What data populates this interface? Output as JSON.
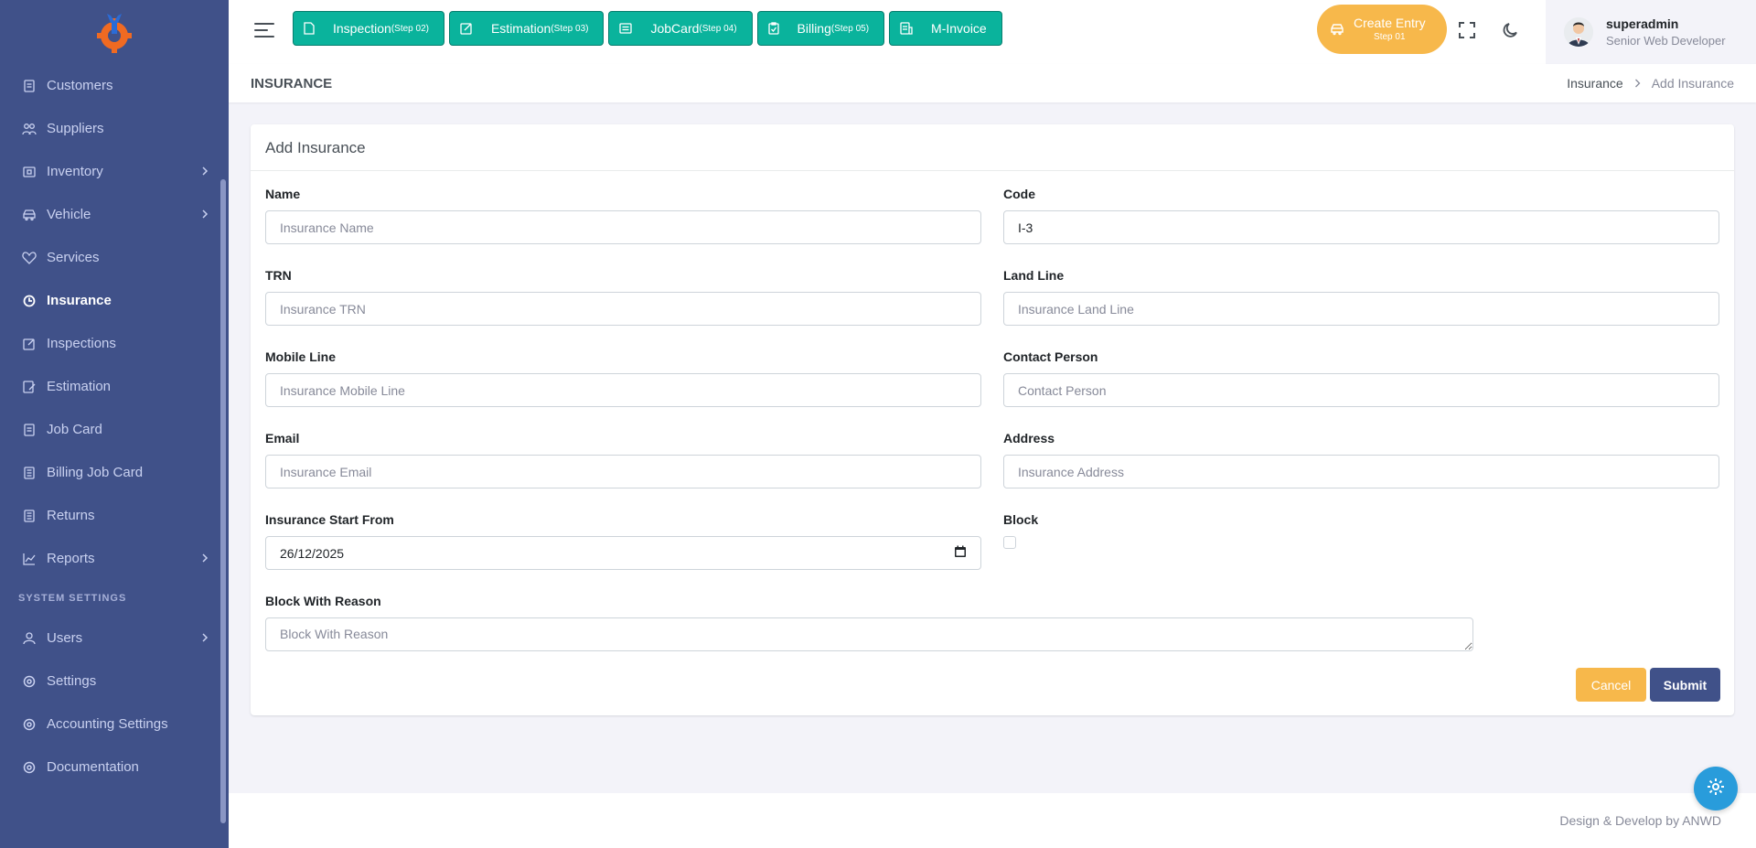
{
  "sidebar": {
    "items": [
      {
        "label": "Customers",
        "icon": "document-icon"
      },
      {
        "label": "Suppliers",
        "icon": "people-icon"
      },
      {
        "label": "Inventory",
        "icon": "box-icon"
      },
      {
        "label": "Vehicle",
        "icon": "car-icon"
      },
      {
        "label": "Services",
        "icon": "heart-icon"
      },
      {
        "label": "Insurance",
        "icon": "insurance-icon"
      },
      {
        "label": "Inspections",
        "icon": "edit-box-icon"
      },
      {
        "label": "Estimation",
        "icon": "edit-doc-icon"
      },
      {
        "label": "Job Card",
        "icon": "document-icon"
      },
      {
        "label": "Billing Job Card",
        "icon": "list-icon"
      },
      {
        "label": "Returns",
        "icon": "list-icon"
      },
      {
        "label": "Reports",
        "icon": "chart-icon"
      }
    ],
    "section_title": "SYSTEM SETTINGS",
    "system_items": [
      {
        "label": "Users",
        "icon": "user-icon"
      },
      {
        "label": "Settings",
        "icon": "settings-icon"
      },
      {
        "label": "Accounting Settings",
        "icon": "settings-icon"
      },
      {
        "label": "Documentation",
        "icon": "settings-icon"
      }
    ]
  },
  "topbar": {
    "steps": [
      {
        "label": "Inspection",
        "step": "(Step 02)"
      },
      {
        "label": "Estimation",
        "step": "(Step 03)"
      },
      {
        "label": "JobCard",
        "step": "(Step 04)"
      },
      {
        "label": "Billing",
        "step": "(Step 05)"
      },
      {
        "label": "M-Invoice",
        "step": ""
      }
    ],
    "create_entry": {
      "label": "Create Entry",
      "step": "Step 01"
    },
    "user": {
      "name": "superadmin",
      "role": "Senior Web Developer"
    }
  },
  "page": {
    "title": "INSURANCE",
    "breadcrumb": {
      "parent": "Insurance",
      "current": "Add Insurance"
    }
  },
  "form": {
    "title": "Add Insurance",
    "name": {
      "label": "Name",
      "placeholder": "Insurance Name"
    },
    "code": {
      "label": "Code",
      "value": "I-3"
    },
    "trn": {
      "label": "TRN",
      "placeholder": "Insurance TRN"
    },
    "landline": {
      "label": "Land Line",
      "placeholder": "Insurance Land Line"
    },
    "mobile": {
      "label": "Mobile Line",
      "placeholder": "Insurance Mobile Line"
    },
    "contact": {
      "label": "Contact Person",
      "placeholder": "Contact Person"
    },
    "email": {
      "label": "Email",
      "placeholder": "Insurance Email"
    },
    "address": {
      "label": "Address",
      "placeholder": "Insurance Address"
    },
    "start": {
      "label": "Insurance Start From",
      "value": "26/12/2025"
    },
    "block": {
      "label": "Block",
      "checked": false
    },
    "reason": {
      "label": "Block With Reason",
      "placeholder": "Block With Reason"
    },
    "cancel_label": "Cancel",
    "submit_label": "Submit"
  },
  "footer": {
    "text": "Design & Develop by ANWD"
  },
  "colors": {
    "sidebar": "#405189",
    "step_button": "#0ab39c",
    "warning": "#f7b84b",
    "primary": "#405189",
    "fab": "#299cdb"
  }
}
